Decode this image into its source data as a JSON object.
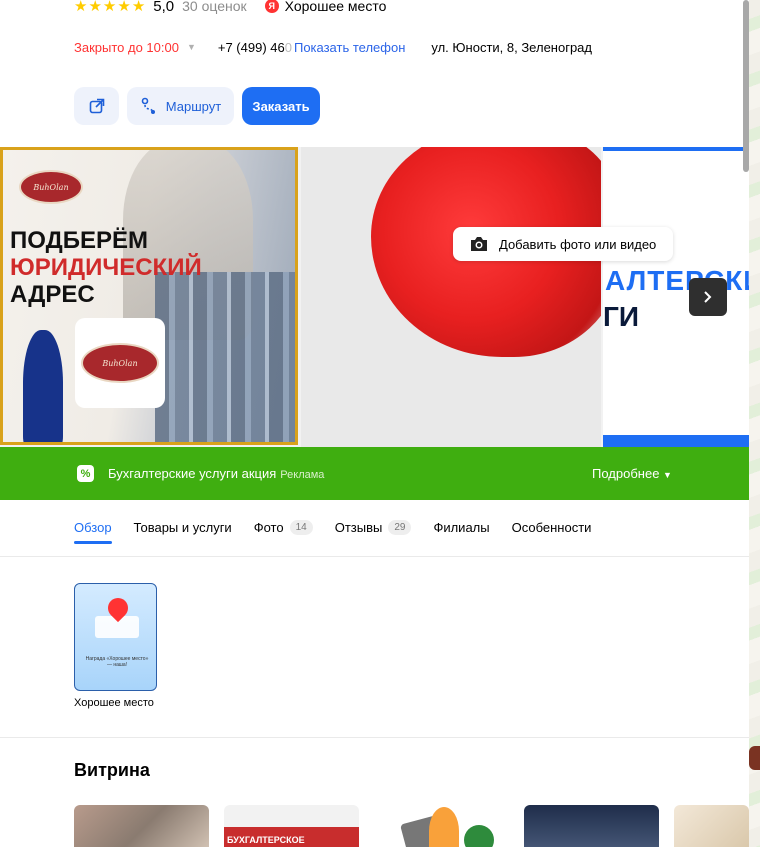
{
  "header": {
    "rating_value": "5,0",
    "reviews_count": "30 оценок",
    "badge_letter": "Я",
    "good_place": "Хорошее место",
    "status": "Закрыто до 10:00",
    "phone_visible": "+7 (499) 46",
    "phone_hidden": "0",
    "show_phone": "Показать телефон",
    "address": "ул. Юности, 8, Зеленоград"
  },
  "actions": {
    "route_label": "Маршрут",
    "order_label": "Заказать"
  },
  "gallery": {
    "photo1": {
      "logo_text": "BuhOlan",
      "headline_1": "ПОДБЕРЁМ",
      "headline_2": "ЮРИДИЧЕСКИЙ",
      "headline_3": "АДРЕС"
    },
    "add_photo_label": "Добавить фото или видео",
    "photo3": {
      "text_1": "АЛТЕРСКИ",
      "text_2": "ГИ"
    }
  },
  "promo": {
    "title": "Бухгалтерские услуги акция",
    "ad_label": "Реклама",
    "more_label": "Подробнее"
  },
  "tabs": [
    {
      "label": "Обзор",
      "count": ""
    },
    {
      "label": "Товары и услуги",
      "count": ""
    },
    {
      "label": "Фото",
      "count": "14"
    },
    {
      "label": "Отзывы",
      "count": "29"
    },
    {
      "label": "Филиалы",
      "count": ""
    },
    {
      "label": "Особенности",
      "count": ""
    }
  ],
  "award": {
    "card_caption": "Награда «Хорошее место» — наша!",
    "label": "Хорошее место"
  },
  "showcase": {
    "title": "Витрина",
    "thumb2_text": "БУХГАЛТЕРСКОЕ"
  },
  "colors": {
    "accent": "#1e6ef3",
    "promo_bg": "#3fae10",
    "closed": "#ff3333",
    "star": "#ffcc00"
  }
}
